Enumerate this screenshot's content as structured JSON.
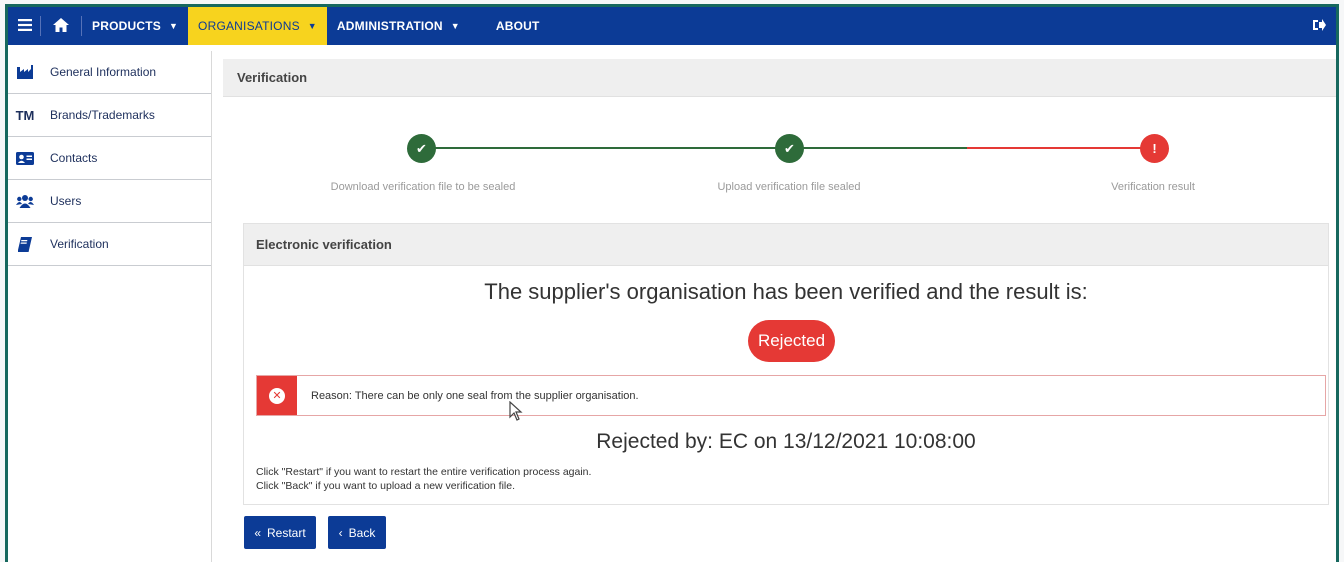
{
  "topnav": {
    "menu_icon": "hamburger-icon",
    "home_icon": "home-icon",
    "items": [
      {
        "label": "PRODUCTS",
        "caret": "▼"
      },
      {
        "label": "ORGANISATIONS",
        "caret": "▼"
      },
      {
        "label": "ADMINISTRATION",
        "caret": "▼"
      },
      {
        "label": "ABOUT"
      }
    ],
    "logout_icon": "logout-icon"
  },
  "sidebar": {
    "items": [
      {
        "label": "General Information",
        "icon": "factory-icon"
      },
      {
        "label": "Brands/Trademarks",
        "icon_text": "TM"
      },
      {
        "label": "Contacts",
        "icon": "contact-card-icon"
      },
      {
        "label": "Users",
        "icon": "users-icon"
      },
      {
        "label": "Verification",
        "icon": "book-icon"
      }
    ]
  },
  "main": {
    "panel_title": "Verification",
    "steps": [
      {
        "label": "Download verification file to be sealed",
        "status": "done",
        "symbol": "✔"
      },
      {
        "label": "Upload verification file sealed",
        "status": "done",
        "symbol": "✔"
      },
      {
        "label": "Verification result",
        "status": "error",
        "symbol": "!"
      }
    ],
    "electronic_verification": {
      "title": "Electronic verification",
      "result_heading": "The supplier's organisation has been verified and the result is:",
      "result_badge": "Rejected",
      "reason": "Reason: There can be only one seal from the supplier organisation.",
      "rejected_by": "Rejected by: EC on 13/12/2021 10:08:00",
      "help_restart": "Click \"Restart\" if you want to restart the entire verification process again.",
      "help_back": "Click \"Back\" if you want to upload a new verification file."
    },
    "buttons": {
      "restart": {
        "icon": "«",
        "label": "Restart"
      },
      "back": {
        "icon": "‹",
        "label": "Back"
      }
    }
  },
  "colors": {
    "nav_bg": "#0c3b96",
    "nav_active": "#f7d31e",
    "success": "#2e6b3a",
    "error": "#e53935",
    "frame": "#17685e"
  }
}
